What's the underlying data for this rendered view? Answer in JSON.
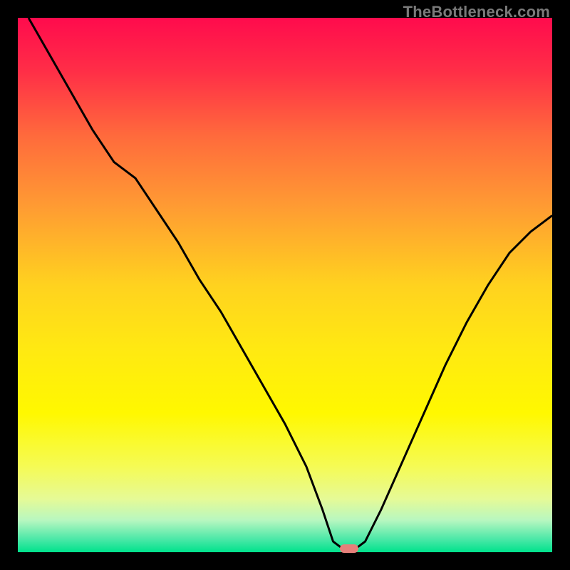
{
  "watermark": "TheBottleneck.com",
  "marker": {
    "x_pct": 62,
    "y_pct": 99.3
  },
  "gradient": {
    "stops": [
      {
        "offset": 0.0,
        "color": "#ff0b4d"
      },
      {
        "offset": 0.1,
        "color": "#ff2e47"
      },
      {
        "offset": 0.22,
        "color": "#ff6a3c"
      },
      {
        "offset": 0.35,
        "color": "#ff9a33"
      },
      {
        "offset": 0.5,
        "color": "#ffd21f"
      },
      {
        "offset": 0.62,
        "color": "#ffe912"
      },
      {
        "offset": 0.74,
        "color": "#fff800"
      },
      {
        "offset": 0.84,
        "color": "#f5fb55"
      },
      {
        "offset": 0.9,
        "color": "#e6fa96"
      },
      {
        "offset": 0.94,
        "color": "#b8f7c0"
      },
      {
        "offset": 0.975,
        "color": "#4de8a8"
      },
      {
        "offset": 1.0,
        "color": "#00e28c"
      }
    ]
  },
  "chart_data": {
    "type": "line",
    "title": "",
    "xlabel": "",
    "ylabel": "",
    "xlim": [
      0,
      100
    ],
    "ylim": [
      0,
      100
    ],
    "series": [
      {
        "name": "bottleneck-curve",
        "x": [
          2,
          6,
          10,
          14,
          18,
          22,
          26,
          30,
          34,
          38,
          42,
          46,
          50,
          54,
          57,
          59,
          61,
          63,
          65,
          68,
          72,
          76,
          80,
          84,
          88,
          92,
          96,
          100
        ],
        "y": [
          100,
          93,
          86,
          79,
          73,
          70,
          64,
          58,
          51,
          45,
          38,
          31,
          24,
          16,
          8,
          2,
          0.5,
          0.5,
          2,
          8,
          17,
          26,
          35,
          43,
          50,
          56,
          60,
          63
        ]
      }
    ],
    "annotations": [
      {
        "type": "marker",
        "x": 62,
        "y": 0.7,
        "label": "optimal-point"
      }
    ]
  }
}
